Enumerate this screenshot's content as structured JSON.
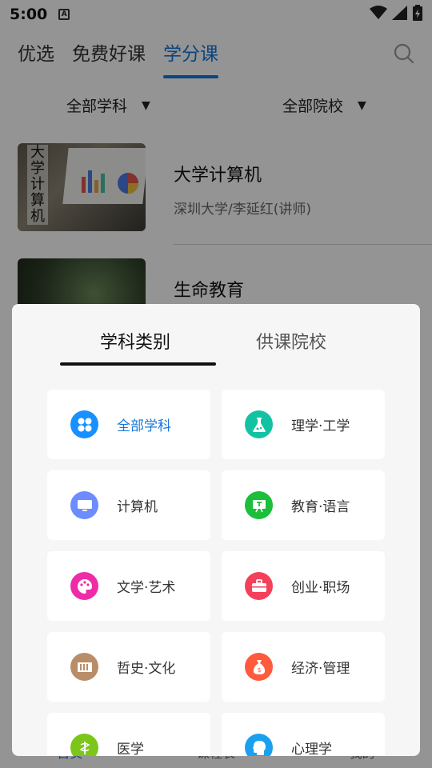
{
  "status": {
    "time": "5:00",
    "notif_glyph": "A"
  },
  "top_tabs": [
    {
      "label": "优选"
    },
    {
      "label": "免费好课"
    },
    {
      "label": "学分课"
    }
  ],
  "active_top_tab": 2,
  "filters": {
    "subject": "全部学科",
    "school": "全部院校",
    "arrow": "▼"
  },
  "courses": [
    {
      "title": "大学计算机",
      "subtitle": "深圳大学/李延红(讲师)",
      "thumb_text": "大学计算机"
    },
    {
      "title": "生命教育",
      "subtitle": ""
    }
  ],
  "bottom_nav": [
    {
      "label": "首页"
    },
    {
      "label": "课程表"
    },
    {
      "label": "我的"
    }
  ],
  "sheet": {
    "tabs": [
      {
        "label": "学科类别"
      },
      {
        "label": "供课院校"
      }
    ],
    "active_tab": 0,
    "categories": [
      {
        "label": "全部学科",
        "icon": "grid-icon",
        "color": "#1890ff",
        "selected": true
      },
      {
        "label": "理学·工学",
        "icon": "flask-icon",
        "color": "#13c2a3",
        "selected": false
      },
      {
        "label": "计算机",
        "icon": "monitor-icon",
        "color": "#6c8cff",
        "selected": false
      },
      {
        "label": "教育·语言",
        "icon": "chalkboard-icon",
        "color": "#1bbf3a",
        "selected": false
      },
      {
        "label": "文学·艺术",
        "icon": "palette-icon",
        "color": "#ee2ca8",
        "selected": false
      },
      {
        "label": "创业·职场",
        "icon": "briefcase-icon",
        "color": "#f5405a",
        "selected": false
      },
      {
        "label": "哲史·文化",
        "icon": "books-icon",
        "color": "#b98d68",
        "selected": false
      },
      {
        "label": "经济·管理",
        "icon": "moneybag-icon",
        "color": "#ff5a3c",
        "selected": false
      },
      {
        "label": "医学",
        "icon": "medicine-icon",
        "color": "#7cc61a",
        "selected": false
      },
      {
        "label": "心理学",
        "icon": "head-icon",
        "color": "#1ba0f0",
        "selected": false
      }
    ]
  },
  "colors": {
    "accent": "#1677d9",
    "overlay": "rgba(0,0,0,0.42)",
    "sheet_bg": "#f6f6f6"
  }
}
